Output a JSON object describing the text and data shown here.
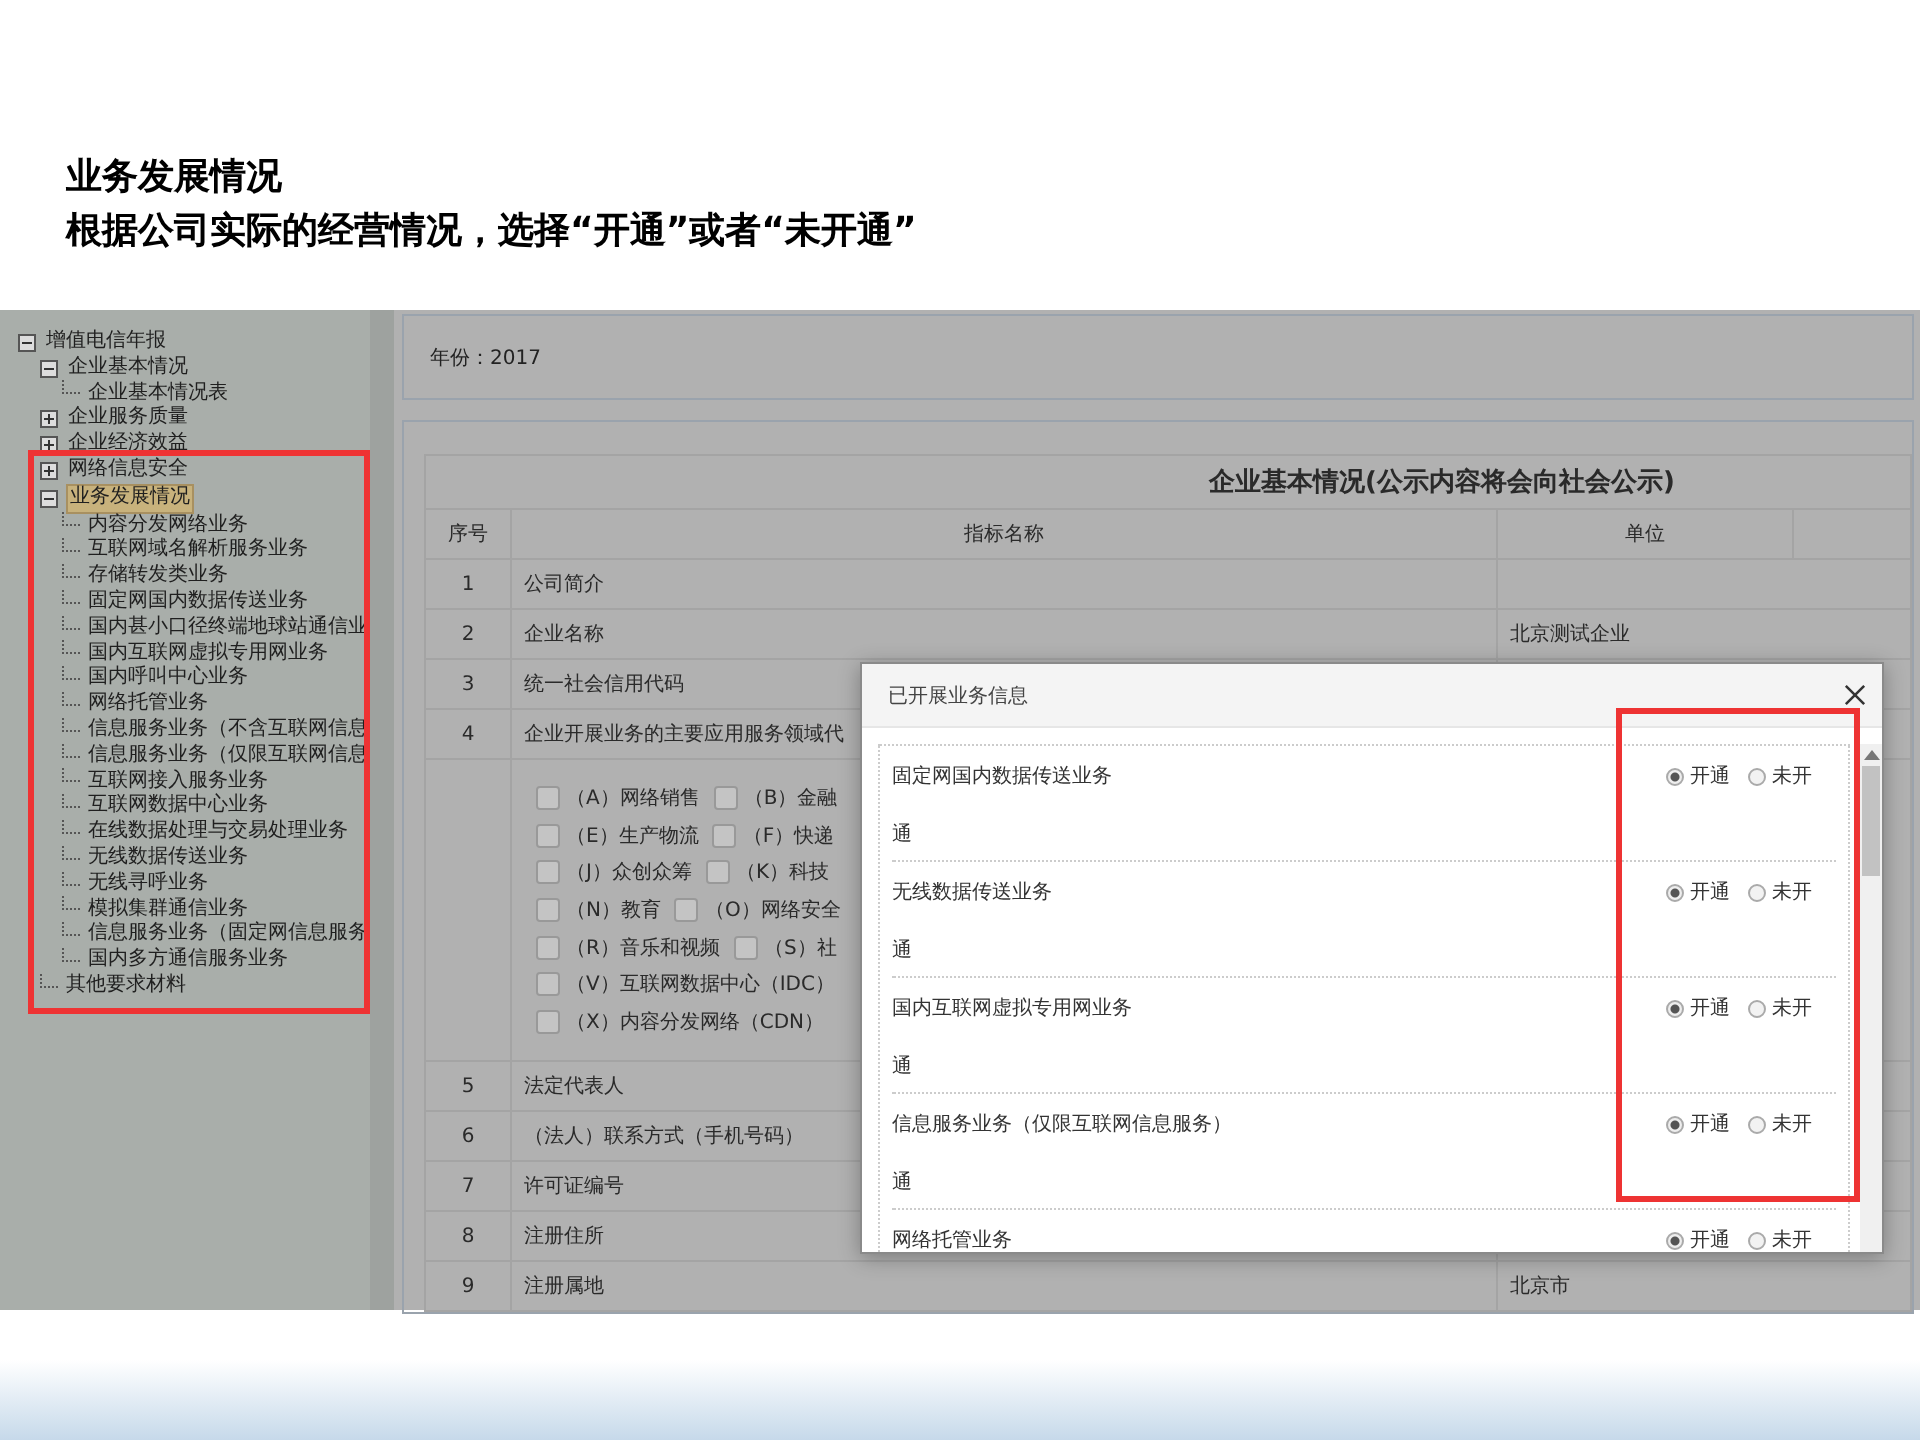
{
  "slide": {
    "heading": "业务发展情况",
    "instruction": "根据公司实际的经营情况，选择“开通”或者“未开通”"
  },
  "tree": [
    {
      "label": "增值电信年报",
      "expanded": true,
      "selected": false,
      "children": [
        {
          "label": "企业基本情况",
          "expanded": true,
          "selected": false,
          "children": [
            {
              "label": "企业基本情况表",
              "selected": false
            }
          ]
        },
        {
          "label": "企业服务质量",
          "expanded": false,
          "selected": false
        },
        {
          "label": "企业经济效益",
          "expanded": false,
          "selected": false
        },
        {
          "label": "网络信息安全",
          "expanded": false,
          "selected": false
        },
        {
          "label": "业务发展情况",
          "expanded": true,
          "selected": true,
          "children": [
            {
              "label": "内容分发网络业务",
              "selected": false
            },
            {
              "label": "互联网域名解析服务业务",
              "selected": false
            },
            {
              "label": "存储转发类业务",
              "selected": false
            },
            {
              "label": "固定网国内数据传送业务",
              "selected": false
            },
            {
              "label": "国内甚小口径终端地球站通信业",
              "selected": false
            },
            {
              "label": "国内互联网虚拟专用网业务",
              "selected": false
            },
            {
              "label": "国内呼叫中心业务",
              "selected": false
            },
            {
              "label": "网络托管业务",
              "selected": false
            },
            {
              "label": "信息服务业务（不含互联网信息",
              "selected": false
            },
            {
              "label": "信息服务业务（仅限互联网信息",
              "selected": false
            },
            {
              "label": "互联网接入服务业务",
              "selected": false
            },
            {
              "label": "互联网数据中心业务",
              "selected": false
            },
            {
              "label": "在线数据处理与交易处理业务",
              "selected": false
            },
            {
              "label": "无线数据传送业务",
              "selected": false
            },
            {
              "label": "无线寻呼业务",
              "selected": false
            },
            {
              "label": "模拟集群通信业务",
              "selected": false
            },
            {
              "label": "信息服务业务（固定网信息服务",
              "selected": false
            },
            {
              "label": "国内多方通信服务业务",
              "selected": false
            }
          ]
        },
        {
          "label": "其他要求材料",
          "selected": false
        }
      ]
    }
  ],
  "year_label": "年份：2017",
  "table": {
    "title": "企业基本情况(公示内容将会向社会公示)",
    "columns": [
      "序号",
      "指标名称",
      "单位"
    ],
    "rows": [
      {
        "kind": "field",
        "index": "1",
        "name": "公司简介"
      },
      {
        "kind": "field",
        "index": "2",
        "name": "企业名称",
        "unit": "北京测试企业"
      },
      {
        "kind": "field",
        "index": "3",
        "name": "统一社会信用代码"
      },
      {
        "kind": "field",
        "index": "4",
        "name": "企业开展业务的主要应用服务领域代"
      },
      {
        "kind": "options",
        "lines": [
          [
            {
              "label": "（A）网络销售",
              "checked": false
            },
            {
              "label": "（B）金融",
              "checked": false
            }
          ],
          [
            {
              "label": "（E）生产物流",
              "checked": false
            },
            {
              "label": "（F）快递",
              "checked": false
            }
          ],
          [
            {
              "label": "（J）众创众筹",
              "checked": false
            },
            {
              "label": "（K）科技",
              "checked": false
            }
          ],
          [
            {
              "label": "（N）教育",
              "checked": false
            },
            {
              "label": "（O）网络安全",
              "checked": false
            }
          ],
          [
            {
              "label": "（R）音乐和视频",
              "checked": false
            },
            {
              "label": "（S）社",
              "checked": false
            }
          ],
          [
            {
              "label": "（V）互联网数据中心（IDC）",
              "checked": false
            }
          ],
          [
            {
              "label": "（X）内容分发网络（CDN）",
              "checked": false
            }
          ]
        ]
      },
      {
        "kind": "field",
        "index": "5",
        "name": "法定代表人"
      },
      {
        "kind": "field",
        "index": "6",
        "name": "（法人）联系方式（手机号码）"
      },
      {
        "kind": "field",
        "index": "7",
        "name": "许可证编号"
      },
      {
        "kind": "field",
        "index": "8",
        "name": "注册住所"
      },
      {
        "kind": "field",
        "index": "9",
        "name": "注册属地",
        "unit": "北京市"
      }
    ]
  },
  "modal": {
    "title": "已开展业务信息",
    "services": [
      {
        "name": "固定网国内数据传送业务",
        "options": [
          {
            "label": "开通",
            "selected": true
          },
          {
            "label": "未开",
            "selected": false
          }
        ],
        "wrapped_text": "通"
      },
      {
        "name": "无线数据传送业务",
        "options": [
          {
            "label": "开通",
            "selected": true
          },
          {
            "label": "未开",
            "selected": false
          }
        ],
        "wrapped_text": "通"
      },
      {
        "name": "国内互联网虚拟专用网业务",
        "options": [
          {
            "label": "开通",
            "selected": true
          },
          {
            "label": "未开",
            "selected": false
          }
        ],
        "wrapped_text": "通"
      },
      {
        "name": "信息服务业务（仅限互联网信息服务）",
        "options": [
          {
            "label": "开通",
            "selected": true
          },
          {
            "label": "未开",
            "selected": false
          }
        ],
        "wrapped_text": "通"
      },
      {
        "name": "网络托管业务",
        "options": [
          {
            "label": "开通",
            "selected": true
          },
          {
            "label": "未开",
            "selected": false
          }
        ]
      }
    ]
  }
}
